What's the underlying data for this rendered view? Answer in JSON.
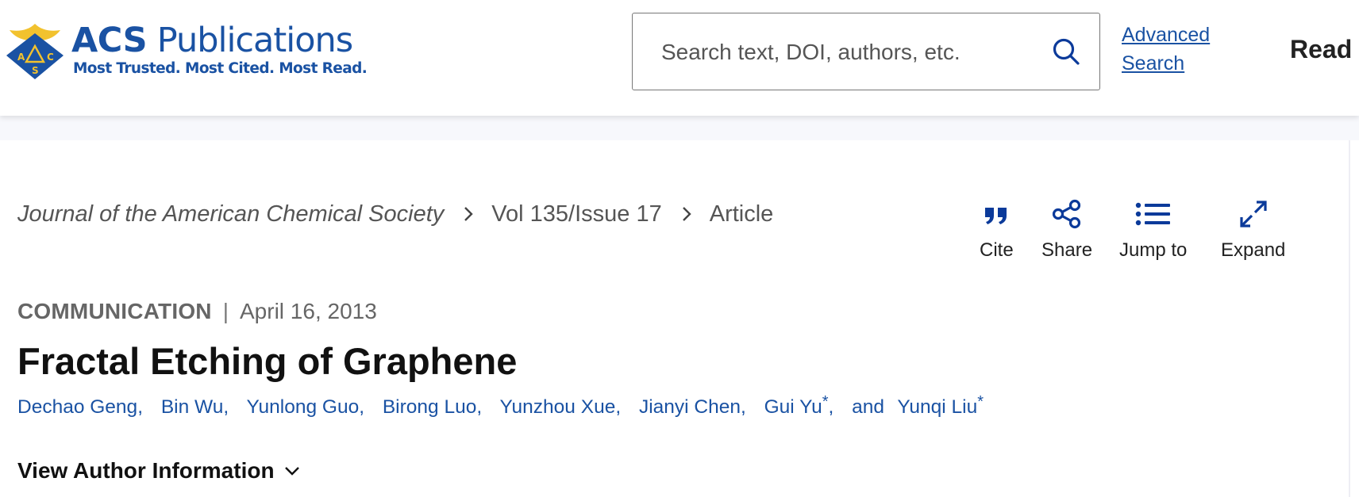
{
  "header": {
    "logo": {
      "wordmark_bold": "ACS",
      "wordmark_light": "Publications",
      "tagline": "Most Trusted. Most Cited. Most Read.",
      "emblem_letters": [
        "A",
        "C",
        "S"
      ]
    },
    "search": {
      "placeholder": "Search text, DOI, authors, etc.",
      "value": "",
      "icon": "search-icon"
    },
    "advanced_search_label": "Advanced Search",
    "read_label": "Read"
  },
  "breadcrumb": {
    "journal": "Journal of the American Chemical Society",
    "issue": "Vol 135/Issue 17",
    "current": "Article"
  },
  "tools": [
    {
      "label": "Cite",
      "icon": "quote-icon"
    },
    {
      "label": "Share",
      "icon": "share-icon"
    },
    {
      "label": "Jump to",
      "icon": "list-icon"
    },
    {
      "label": "Expand",
      "icon": "expand-icon"
    }
  ],
  "article": {
    "type": "COMMUNICATION",
    "separator": "|",
    "date": "April 16, 2013",
    "title": "Fractal Etching of Graphene",
    "authors": [
      {
        "name": "Dechao Geng",
        "sep": ",",
        "corresponding": ""
      },
      {
        "name": "Bin Wu",
        "sep": ",",
        "corresponding": ""
      },
      {
        "name": "Yunlong Guo",
        "sep": ",",
        "corresponding": ""
      },
      {
        "name": "Birong Luo",
        "sep": ",",
        "corresponding": ""
      },
      {
        "name": "Yunzhou Xue",
        "sep": ",",
        "corresponding": ""
      },
      {
        "name": "Jianyi Chen",
        "sep": ",",
        "corresponding": ""
      },
      {
        "name": "Gui Yu",
        "sep": ",",
        "corresponding": "*"
      },
      {
        "name": "Yunqi Liu",
        "sep": "",
        "corresponding": "*"
      }
    ],
    "and_word": "and",
    "view_author_info_label": "View Author Information"
  },
  "colors": {
    "brand_blue": "#1a52a3",
    "icon_blue": "#0b3a9a",
    "logo_gold": "#f2c22e",
    "text_dark": "#111111",
    "text_muted": "#666666"
  }
}
